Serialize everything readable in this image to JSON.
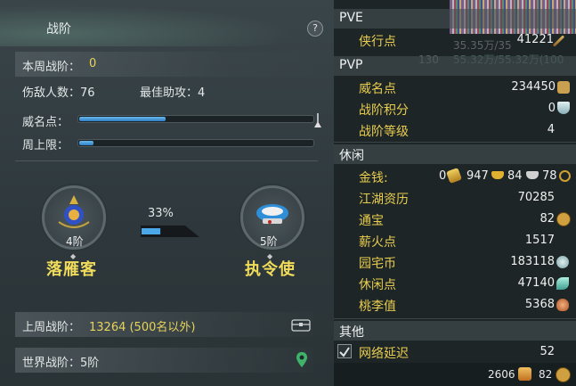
{
  "left": {
    "title": "战阶",
    "help": "?",
    "week_label": "本周战阶：",
    "week_value": "0",
    "defeated": "伤敌人数：76",
    "best_assist": "最佳助攻：4",
    "prestige_label": "威名点：",
    "prestige_progress": 0.37,
    "cap_label": "周上限：",
    "cap_progress": 0.06,
    "progress_pct": "33%",
    "progress_fraction": 0.33,
    "rank_current": {
      "tier": "4阶",
      "name": "落雁客"
    },
    "rank_next": {
      "tier": "5阶",
      "name": "执令使"
    },
    "last_week_label": "上周战阶：",
    "last_week_value": "13264 (500名以外)",
    "world_rank": "世界战阶：5阶"
  },
  "right": {
    "pve": {
      "title": "PVE",
      "items": [
        {
          "label": "侠行点",
          "value": "41221"
        }
      ]
    },
    "pvp": {
      "title": "PVP",
      "items": [
        {
          "label": "威名点",
          "value": "234450"
        },
        {
          "label": "战阶积分",
          "value": "0"
        },
        {
          "label": "战阶等级",
          "value": "4"
        }
      ]
    },
    "leisure": {
      "title": "休闲",
      "money_label": "金钱:",
      "money": {
        "a": "0",
        "b": "947",
        "c": "84",
        "d": "78"
      },
      "items": [
        {
          "label": "江湖资历",
          "value": "70285"
        },
        {
          "label": "通宝",
          "value": "82"
        },
        {
          "label": "薪火点",
          "value": "1517"
        },
        {
          "label": "园宅币",
          "value": "183118"
        },
        {
          "label": "休闲点",
          "value": "47140"
        },
        {
          "label": "桃李值",
          "value": "5368"
        }
      ]
    },
    "other": {
      "title": "其他",
      "items": [
        {
          "label": "网络延迟",
          "value": "52"
        }
      ]
    },
    "bottom": {
      "a": "2606",
      "b": "82"
    },
    "bg_numbers": [
      "35.35万/35",
      "55.32万/55.32万(100",
      "130"
    ]
  }
}
